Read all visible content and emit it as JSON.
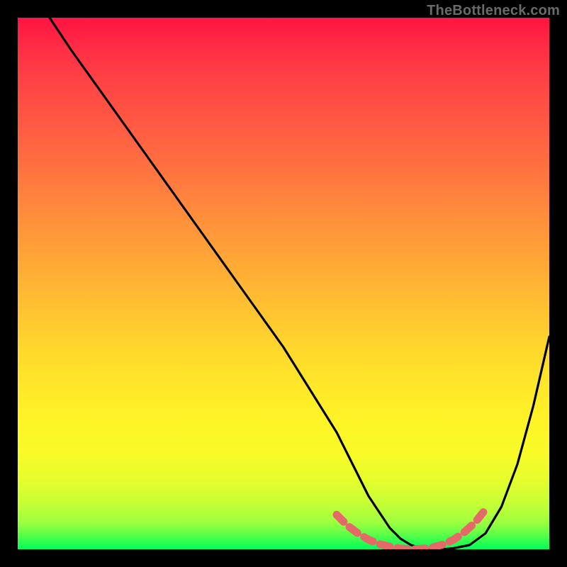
{
  "watermark": "TheBottleneck.com",
  "chart_data": {
    "type": "line",
    "title": "",
    "xlabel": "",
    "ylabel": "",
    "xlim": [
      0,
      100
    ],
    "ylim": [
      0,
      100
    ],
    "x": [
      6,
      10,
      15,
      20,
      25,
      30,
      35,
      40,
      45,
      50,
      55,
      60,
      62,
      64,
      66,
      68,
      70,
      72,
      74,
      76,
      78,
      80,
      82,
      85,
      88,
      91,
      94,
      97,
      100
    ],
    "values": [
      100,
      94,
      87,
      80,
      73,
      66,
      59,
      52,
      45,
      38,
      30,
      22,
      18,
      14,
      10,
      7,
      4,
      2,
      0.8,
      0.2,
      0,
      0,
      0.2,
      0.8,
      3,
      8,
      16,
      27,
      40
    ],
    "marker_band": {
      "x": [
        60,
        62,
        64,
        66,
        68,
        70,
        72,
        74,
        76,
        78,
        80,
        82,
        84,
        86,
        88
      ],
      "values": [
        6.5,
        4.5,
        3.0,
        1.8,
        1.0,
        0.5,
        0.15,
        0,
        0.1,
        0.35,
        0.9,
        1.8,
        3.2,
        5.0,
        7.5
      ]
    },
    "gradient_stops": [
      {
        "pos": 0,
        "color": "#ff1442"
      },
      {
        "pos": 50,
        "color": "#ffb334"
      },
      {
        "pos": 80,
        "color": "#fff427"
      },
      {
        "pos": 100,
        "color": "#00ff59"
      }
    ]
  }
}
